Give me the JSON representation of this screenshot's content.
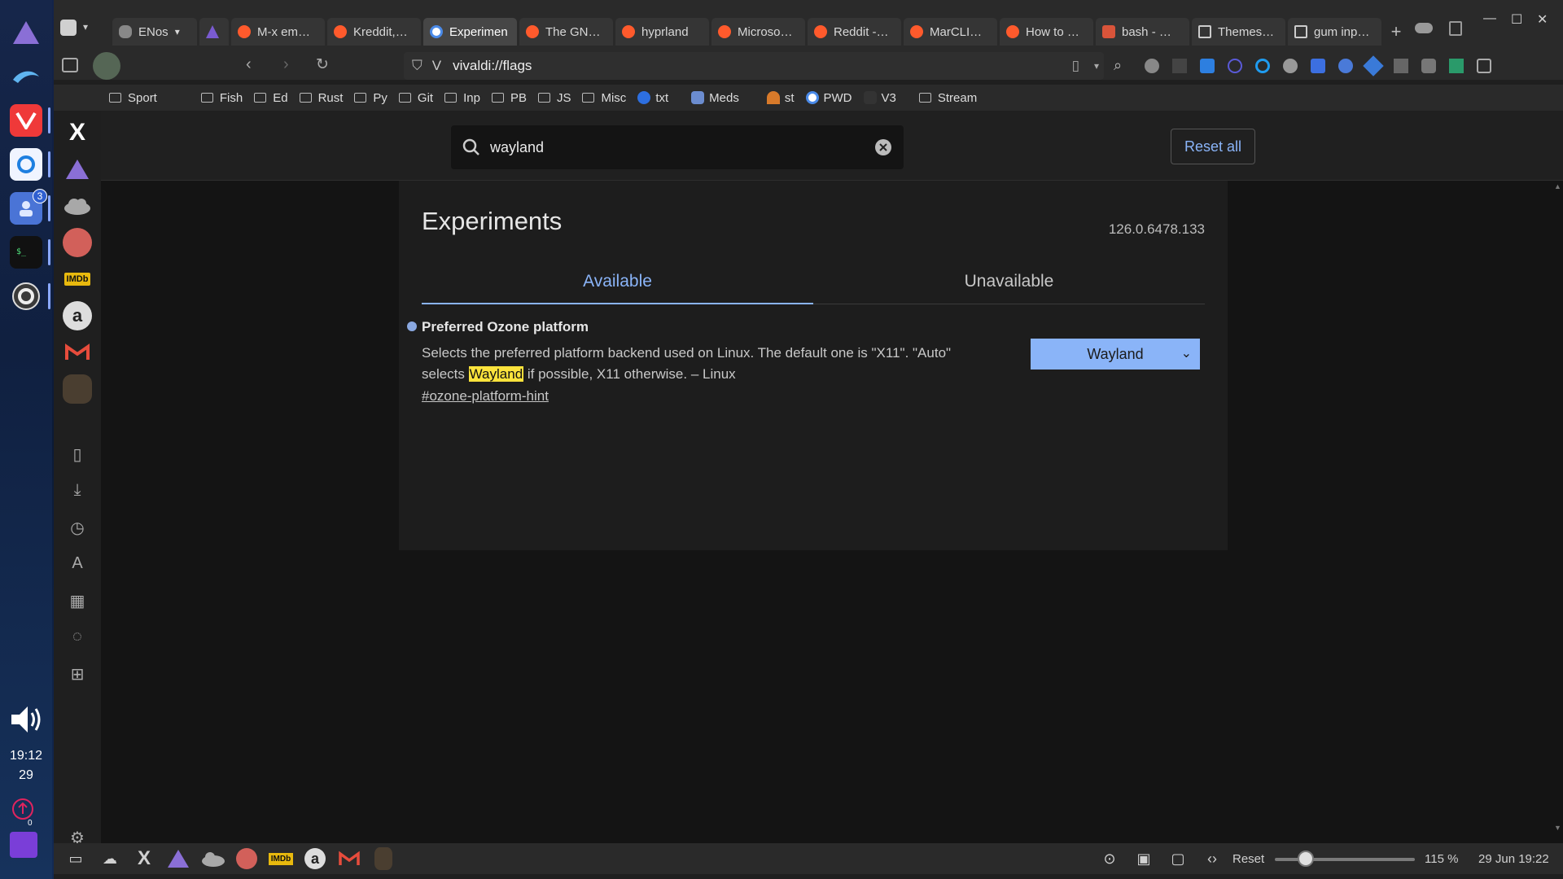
{
  "browser": {
    "workspace_label": "ENos",
    "tabs": [
      {
        "label": "M-x em…"
      },
      {
        "label": "Kreddit,…"
      },
      {
        "label": "Experimen"
      },
      {
        "label": "The GN…"
      },
      {
        "label": "hyprland"
      },
      {
        "label": "Microso…"
      },
      {
        "label": "Reddit -…"
      },
      {
        "label": "MarCLI…"
      },
      {
        "label": "How to …"
      },
      {
        "label": "bash - …"
      },
      {
        "label": "Themes…"
      },
      {
        "label": "gum inp…"
      }
    ],
    "address": "vivaldi://flags",
    "bookmarks": [
      {
        "label": "Sport",
        "type": "folder"
      },
      {
        "label": "Fish",
        "type": "folder"
      },
      {
        "label": "Ed",
        "type": "folder"
      },
      {
        "label": "Rust",
        "type": "folder"
      },
      {
        "label": "Py",
        "type": "folder"
      },
      {
        "label": "Git",
        "type": "folder"
      },
      {
        "label": "Inp",
        "type": "folder"
      },
      {
        "label": "PB",
        "type": "folder"
      },
      {
        "label": "JS",
        "type": "folder"
      },
      {
        "label": "Misc",
        "type": "folder"
      },
      {
        "label": "txt",
        "type": "link"
      },
      {
        "label": "Meds",
        "type": "link"
      },
      {
        "label": "st",
        "type": "link"
      },
      {
        "label": "PWD",
        "type": "link"
      },
      {
        "label": "V3",
        "type": "link"
      },
      {
        "label": "Stream",
        "type": "folder"
      }
    ]
  },
  "flags_page": {
    "search_value": "wayland",
    "reset_label": "Reset all",
    "title": "Experiments",
    "version": "126.0.6478.133",
    "tab_available": "Available",
    "tab_unavailable": "Unavailable",
    "flag": {
      "name": "Preferred Ozone platform",
      "desc_before": "Selects the preferred platform backend used on Linux. The default one is \"X11\". \"Auto\" selects ",
      "desc_highlight": "Wayland",
      "desc_after": " if possible, X11 otherwise. – Linux",
      "link": "#ozone-platform-hint",
      "selected_option": "Wayland"
    }
  },
  "dock": {
    "notification_badge": "3",
    "clock_time": "19:12",
    "clock_day": "29",
    "updates_count": "0"
  },
  "statusbar": {
    "reset_label": "Reset",
    "zoom": "115 %",
    "datetime": "29 Jun 19:22"
  },
  "colors": {
    "accent": "#8ab4f8",
    "highlight": "#fce33c",
    "page_bg": "#141414"
  }
}
